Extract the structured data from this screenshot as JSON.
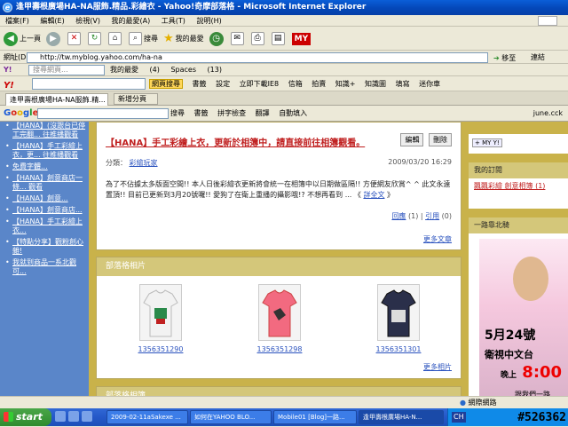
{
  "window": {
    "title": "逢甲壽根廣場HA-NA服飾.精品.彩繪衣 - Yahoo!奇摩部落格 - Microsoft Internet Explorer"
  },
  "menu": {
    "items": [
      "檔案(F)",
      "編輯(E)",
      "檢視(V)",
      "我的最愛(A)",
      "工具(T)",
      "說明(H)"
    ]
  },
  "toolbar": {
    "back": "上一頁",
    "search": "搜尋",
    "favorites": "我的最愛",
    "my_label": "MY"
  },
  "address": {
    "label": "網址(D)",
    "url": "http://tw.myblog.yahoo.com/ha-na",
    "go": "移至",
    "links": "連結"
  },
  "yahoo_bar1": {
    "search_placeholder": "搜尋網頁...",
    "items": [
      "我的最愛",
      "(4)",
      "Spaces",
      "(13)"
    ]
  },
  "yahoo_bar2": {
    "search_btn": "網頁搜尋",
    "items": [
      "書籤",
      "設定",
      "立即下載IE8",
      "信箱",
      "拍賣",
      "知識+",
      "知識圖",
      "填寫",
      "迷你車"
    ]
  },
  "tabs": {
    "active": "逢甲壽根廣場HA-NA服飾.精...",
    "new_tab": "新增分頁"
  },
  "google_bar": {
    "items": [
      "搜尋",
      "書籤",
      "拼字檢查",
      "翻譯",
      "自動填入"
    ],
    "account": "june.cck"
  },
  "left_links": [
    "【HANA】(沒跟台已停工完翻... 往推播觀看",
    "【HANA】手工彩繪上衣，更... 往推播觀看",
    "免費字體...",
    "【HANA】創意商店一條... 觀看",
    "【HANA】創意...",
    "【HANA】創意商店...",
    "【HANA】手工彩繪上衣...",
    "【特點分享】觀粉創心雜!",
    "我就到商品一系北觀可..."
  ],
  "post": {
    "title": "【HANA】手工彩繪上衣，更新於相簿中，請直接前往相簿觀看。",
    "edit_btn": "編輯",
    "delete_btn": "刪除",
    "category_label": "分類：",
    "category": "彩繪玩家",
    "date": "2009/03/20 16:29",
    "body": "為了不佔據太多版面空間!! 本人日後彩繪衣更新將會統一在相簿中以日期做區隔!! 方便網友欣賞^ ^ 此文永遠置頂!! 目前已更新到3月20號囉!! 愛狗了在衛上重播的攝影哦!? 不想再看到 ... 《",
    "read_more": "詳全文",
    "body_end": "》",
    "reply": "回應",
    "reply_count": "(1)",
    "trackback": "引用",
    "trackback_count": "(0)",
    "more_articles": "更多文章"
  },
  "photos": {
    "header": "部落格相片",
    "items": [
      {
        "caption": "1356351290"
      },
      {
        "caption": "1356351298"
      },
      {
        "caption": "1356351301"
      }
    ],
    "more": "更多相片"
  },
  "blog_section": {
    "header": "部落格相簿"
  },
  "right": {
    "myyahoo_badge": "+ MY Y!",
    "subs_header": "我的訂閱",
    "subs_item": "飄飄彩繪 創意相簿 (1)",
    "north_header": "一路靠北騎",
    "ad": {
      "date": "5月24號",
      "channel": "衛視中文台",
      "time_prefix": "晚上",
      "time": "8:00",
      "follow": "跟我們一路"
    }
  },
  "status": {
    "zone": "網際網路"
  },
  "taskbar": {
    "start": "start",
    "tasks": [
      "2009-02-11aSakexe ...",
      "如何在YAHOO BLO...",
      "Mobile01 [Blog]一路...",
      "逢甲壽根廣場HA-N..."
    ],
    "lang": "CH",
    "watermark": "#526362"
  },
  "colors": {
    "page_gold": "#c9b24a",
    "left_blue": "#5a86c9",
    "title_red": "#c02020"
  }
}
